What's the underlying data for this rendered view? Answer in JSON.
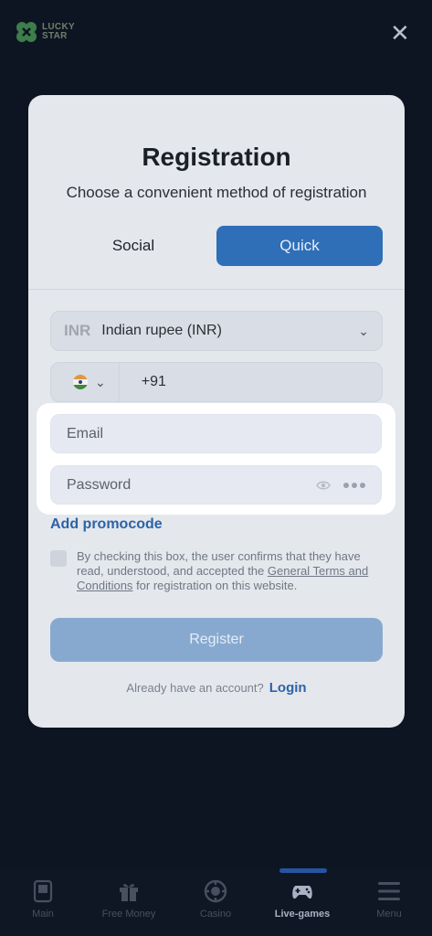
{
  "header": {
    "brand_line1": "LUCKY",
    "brand_line2": "STAR",
    "close_label": "✕"
  },
  "modal": {
    "title": "Registration",
    "subtitle": "Choose a convenient method of registration",
    "tabs": [
      {
        "label": "Social",
        "active": false
      },
      {
        "label": "Quick",
        "active": true
      }
    ],
    "currency": {
      "code": "INR",
      "name": "Indian rupee (INR)"
    },
    "phone": {
      "country_code": "+91"
    },
    "email": {
      "placeholder": "Email"
    },
    "password": {
      "placeholder": "Password"
    },
    "promo_link": "Add promocode",
    "terms": {
      "prefix": "By checking this box, the user confirms that they have read, understood, and accepted the",
      "link": "General Terms and Conditions",
      "suffix": "for registration on this website."
    },
    "register_label": "Register",
    "already_text": "Already have an account?",
    "login_link": "Login"
  },
  "bottom_nav": {
    "items": [
      {
        "label": "Main",
        "icon": "phone-icon",
        "active": false
      },
      {
        "label": "Free Money",
        "icon": "gift-icon",
        "active": false
      },
      {
        "label": "Casino",
        "icon": "chip-icon",
        "active": false
      },
      {
        "label": "Live-games",
        "icon": "gamepad-icon",
        "active": true
      },
      {
        "label": "Menu",
        "icon": "hamburger-icon",
        "active": false
      }
    ]
  },
  "colors": {
    "backdrop": "#0e1522",
    "accent": "#2e6fb8",
    "link": "#2c63a8"
  }
}
